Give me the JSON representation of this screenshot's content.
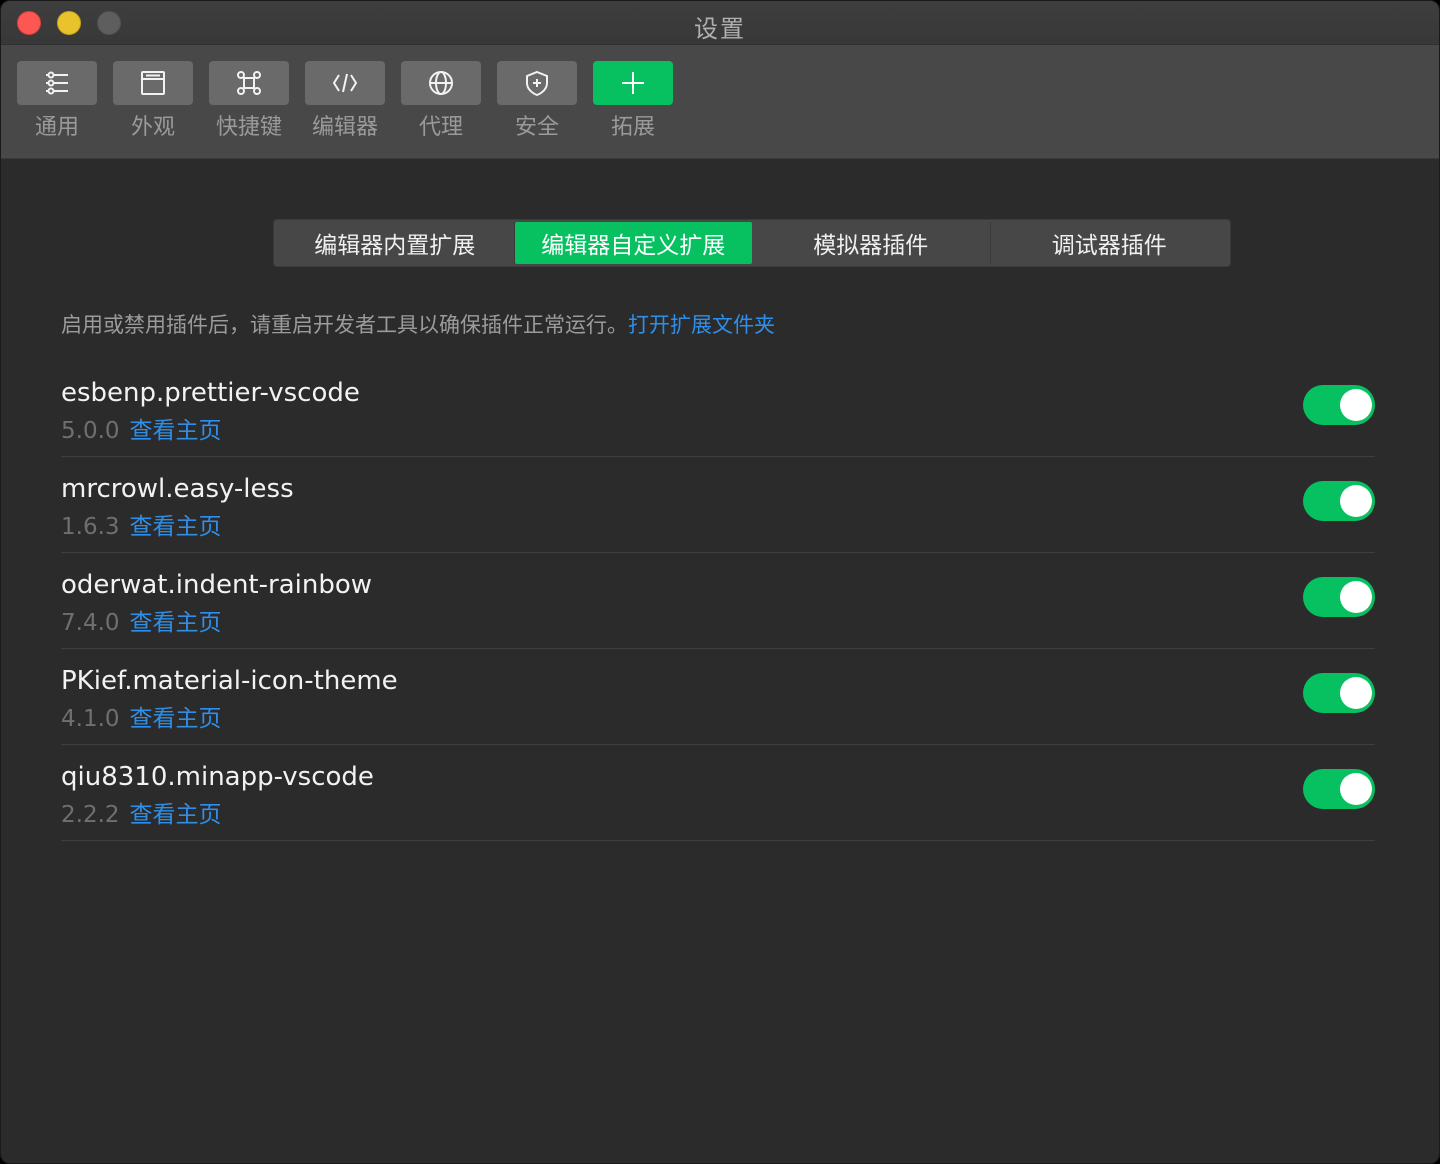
{
  "window": {
    "title": "设置"
  },
  "toolbar": {
    "items": [
      {
        "label": "通用",
        "icon": "sliders-icon"
      },
      {
        "label": "外观",
        "icon": "window-icon"
      },
      {
        "label": "快捷键",
        "icon": "command-key-icon"
      },
      {
        "label": "编辑器",
        "icon": "code-icon"
      },
      {
        "label": "代理",
        "icon": "globe-icon"
      },
      {
        "label": "安全",
        "icon": "shield-icon"
      },
      {
        "label": "拓展",
        "icon": "plus-icon",
        "active": true
      }
    ]
  },
  "tabs": [
    {
      "label": "编辑器内置扩展"
    },
    {
      "label": "编辑器自定义扩展",
      "active": true
    },
    {
      "label": "模拟器插件"
    },
    {
      "label": "调试器插件"
    }
  ],
  "notice": {
    "text": "启用或禁用插件后，请重启开发者工具以确保插件正常运行。",
    "link": "打开扩展文件夹"
  },
  "extensions": [
    {
      "name": "esbenp.prettier-vscode",
      "version": "5.0.0",
      "link": "查看主页",
      "enabled": true
    },
    {
      "name": "mrcrowl.easy-less",
      "version": "1.6.3",
      "link": "查看主页",
      "enabled": true
    },
    {
      "name": "oderwat.indent-rainbow",
      "version": "7.4.0",
      "link": "查看主页",
      "enabled": true
    },
    {
      "name": "PKief.material-icon-theme",
      "version": "4.1.0",
      "link": "查看主页",
      "enabled": true
    },
    {
      "name": "qiu8310.minapp-vscode",
      "version": "2.2.2",
      "link": "查看主页",
      "enabled": true
    }
  ],
  "colors": {
    "accent": "#07c160",
    "link": "#2f8fe8",
    "background": "#2b2b2b",
    "toolbar": "#484848"
  }
}
